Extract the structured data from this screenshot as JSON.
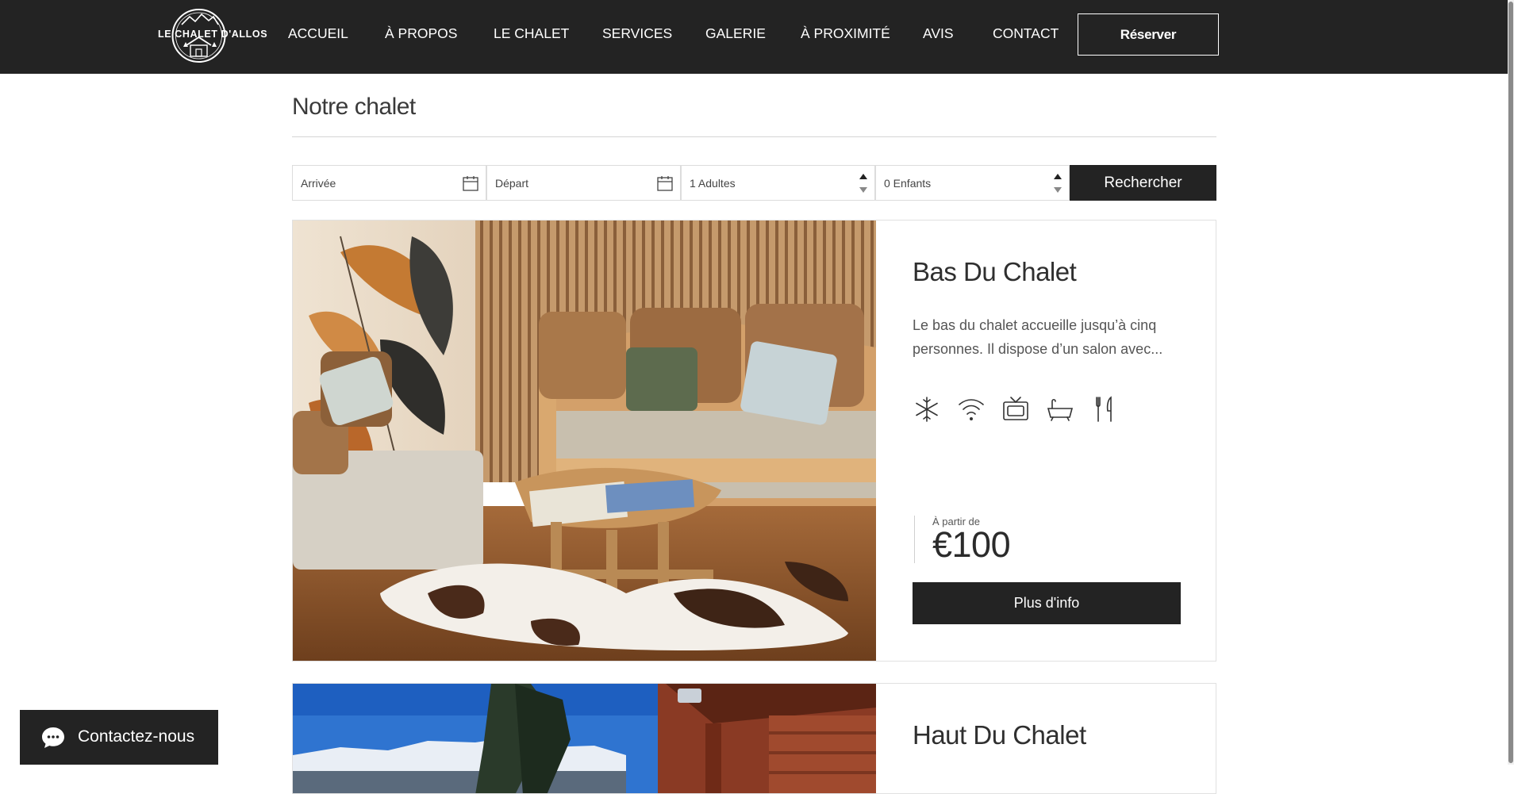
{
  "header": {
    "logo_text": "LE CHALET D'ALLOS",
    "nav": [
      "ACCUEIL",
      "À PROPOS",
      "LE CHALET",
      "SERVICES",
      "GALERIE",
      "À PROXIMITÉ",
      "AVIS",
      "CONTACT"
    ],
    "reserve_label": "Réserver"
  },
  "page_title": "Notre chalet",
  "search": {
    "arrival_placeholder": "Arrivée",
    "departure_placeholder": "Départ",
    "adults_value": "1 Adultes",
    "children_value": "0 Enfants",
    "search_label": "Rechercher"
  },
  "rooms": [
    {
      "title": "Bas Du Chalet",
      "description": "Le bas du chalet accueille jusqu’à cinq personnes. Il dispose d’un salon avec...",
      "amenities": [
        "snowflake-icon",
        "wifi-icon",
        "tv-icon",
        "bathtub-icon",
        "fork-knife-icon"
      ],
      "price_label": "À partir de",
      "price": "€100",
      "cta_label": "Plus d'info"
    },
    {
      "title": "Haut Du Chalet"
    }
  ],
  "chat": {
    "label": "Contactez-nous"
  },
  "colors": {
    "dark": "#232323",
    "white": "#ffffff",
    "border": "#e1e1e1"
  }
}
